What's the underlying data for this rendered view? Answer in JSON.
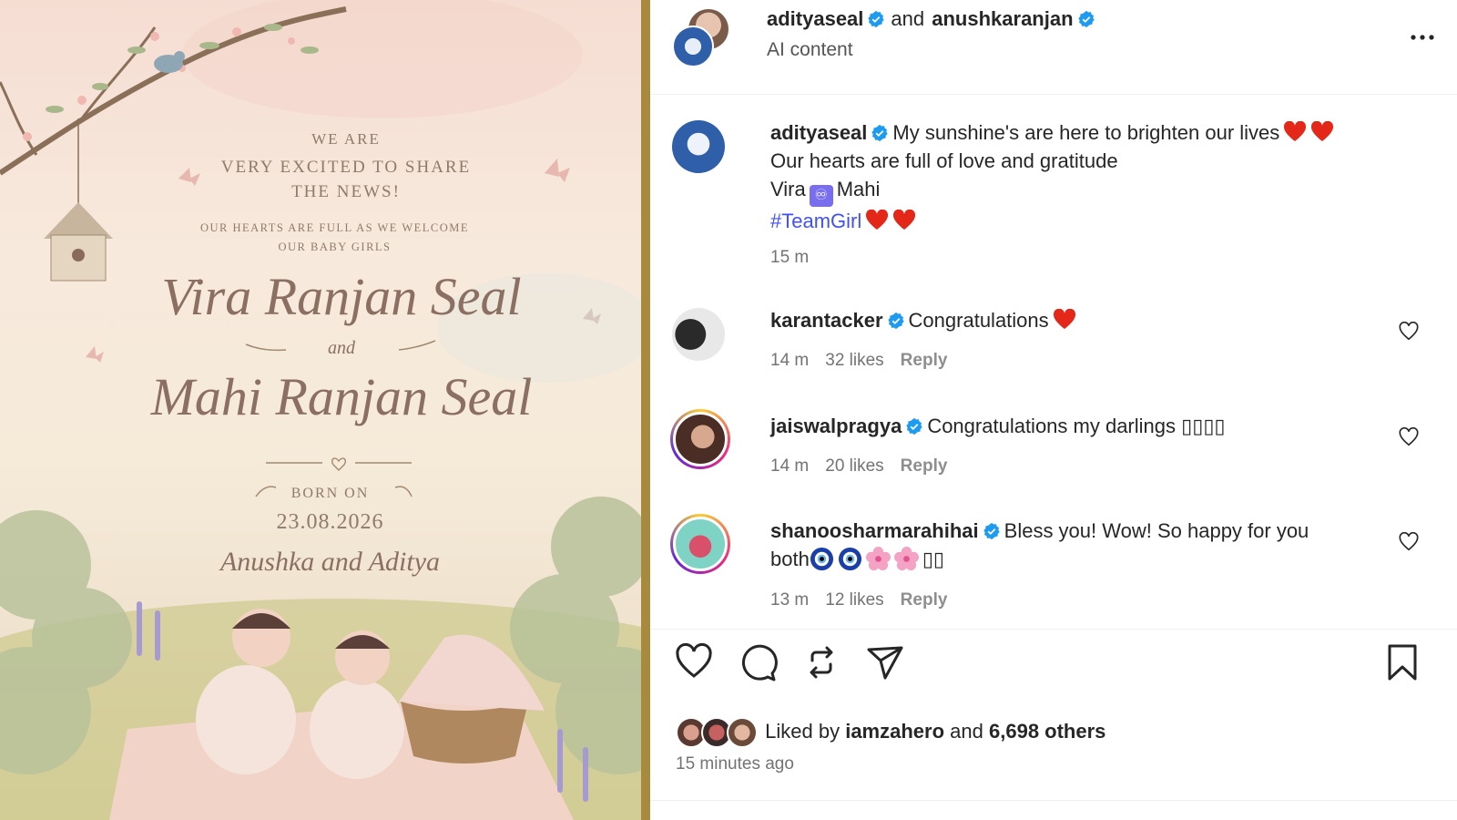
{
  "invite": {
    "line1": "We are",
    "line2a": "very excited to share",
    "line2b": "the news!",
    "line3a": "Our hearts are full as we welcome",
    "line3b": "our baby girls",
    "name1": "Vira Ranjan Seal",
    "and": "and",
    "name2": "Mahi Ranjan Seal",
    "born_label": "Born on",
    "date": "23.08.2026",
    "parents": "Anushka and Aditya"
  },
  "header": {
    "user1": "adityaseal",
    "and_text": "and",
    "user2": "anushkaranjan",
    "subtitle": "AI content",
    "more_icon": "more-horizontal-icon"
  },
  "caption": {
    "username": "adityaseal",
    "line1": "My sunshine's are here to brighten our lives",
    "line2": "Our hearts are full of love and gratitude",
    "line3_a": "Vira",
    "line3_emoji": "♾",
    "line3_b": "Mahi",
    "hashtag": "#TeamGirl",
    "time": "15 m"
  },
  "comments": [
    {
      "username": "karantacker",
      "text": "Congratulations",
      "time": "14 m",
      "likes": "32 likes",
      "reply": "Reply"
    },
    {
      "username": "jaiswalpragya",
      "text": "Congratulations my darlings ▯▯▯▯",
      "time": "14 m",
      "likes": "20 likes",
      "reply": "Reply"
    },
    {
      "username": "shanoosharmarahihai",
      "text": "Bless you! Wow! So happy for you",
      "text2": "both",
      "tail": "▯▯",
      "time": "13 m",
      "likes": "12 likes",
      "reply": "Reply"
    }
  ],
  "likes": {
    "prefix": "Liked by",
    "user": "iamzahero",
    "joiner": "and",
    "others": "6,698 others"
  },
  "timestamp": "15 minutes ago",
  "colors": {
    "verified": "#1d9bf0",
    "hashtag": "#4150f7",
    "heart": "#e3281a",
    "gold": "#a88a3f"
  }
}
